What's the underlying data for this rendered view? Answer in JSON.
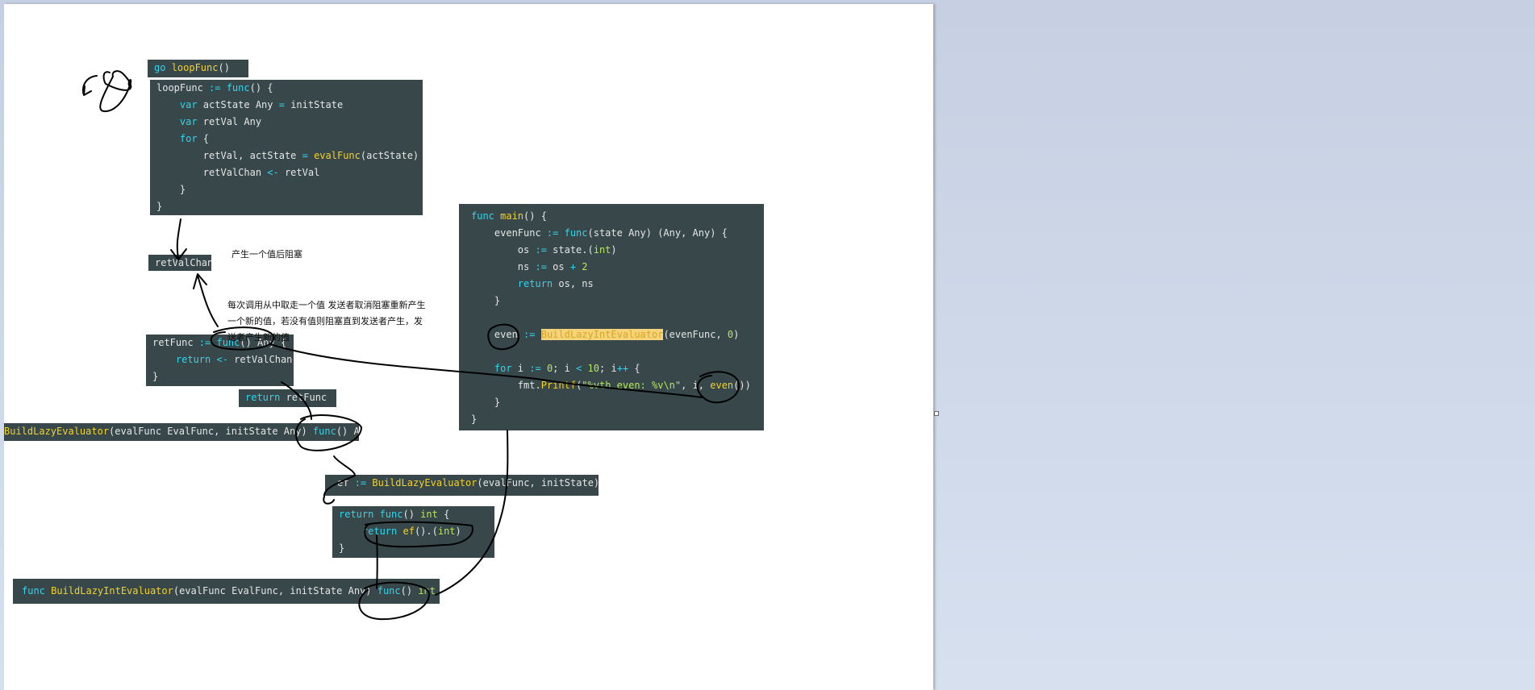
{
  "code_blocks": {
    "go_loop": [
      [
        [
          "kw",
          "go "
        ],
        [
          "fn",
          "loopFunc"
        ],
        [
          "",
          "()"
        ]
      ]
    ],
    "loop_func": [
      [
        [
          "",
          "loopFunc "
        ],
        [
          "op",
          ":="
        ],
        [
          "kw",
          " func"
        ],
        [
          "",
          "() {"
        ]
      ],
      [
        [
          "kw",
          "    var"
        ],
        [
          "",
          " actState Any "
        ],
        [
          "op",
          "="
        ],
        [
          "",
          " initState"
        ]
      ],
      [
        [
          "kw",
          "    var"
        ],
        [
          "",
          " retVal Any"
        ]
      ],
      [
        [
          "kw",
          "    for"
        ],
        [
          "",
          " {"
        ]
      ],
      [
        [
          "",
          "        retVal, actState "
        ],
        [
          "op",
          "="
        ],
        [
          "fn",
          " evalFunc"
        ],
        [
          "",
          "(actState)"
        ]
      ],
      [
        [
          "",
          "        retValChan "
        ],
        [
          "op",
          "<-"
        ],
        [
          "",
          " retVal"
        ]
      ],
      [
        [
          "",
          "    }"
        ]
      ],
      [
        [
          "",
          "}"
        ]
      ]
    ],
    "ret_val_chan": [
      [
        [
          "",
          "retValChan"
        ]
      ]
    ],
    "ret_func": [
      [
        [
          "",
          "retFunc "
        ],
        [
          "op",
          ":="
        ],
        [
          "kw",
          " func"
        ],
        [
          "",
          "() Any {"
        ]
      ],
      [
        [
          "kw",
          "    return"
        ],
        [
          "op",
          " <-"
        ],
        [
          "",
          " retValChan"
        ]
      ],
      [
        [
          "",
          "}"
        ]
      ]
    ],
    "return_ret_func": [
      [
        [
          "kw",
          "return"
        ],
        [
          "",
          " retFunc"
        ]
      ]
    ],
    "build_lazy_evaluator": [
      [
        [
          "fn",
          "BuildLazyEvaluator"
        ],
        [
          "",
          "(evalFunc EvalFunc, initState Any) "
        ],
        [
          "kw",
          "func"
        ],
        [
          "",
          "() Any"
        ]
      ]
    ],
    "ef_assign": [
      [
        [
          "",
          "ef "
        ],
        [
          "op",
          ":="
        ],
        [
          "fn",
          " BuildLazyEvaluator"
        ],
        [
          "",
          "(evalFunc, initState)"
        ]
      ]
    ],
    "return_int_func": [
      [
        [
          "kw",
          "return"
        ],
        [
          "kw",
          " func"
        ],
        [
          "",
          "() "
        ],
        [
          "num",
          "int"
        ],
        [
          "",
          " {"
        ]
      ],
      [
        [
          "kw",
          "    return"
        ],
        [
          "fn",
          " ef"
        ],
        [
          "",
          "()."
        ],
        [
          "",
          "("
        ],
        [
          "num",
          "int"
        ],
        [
          "",
          ")"
        ]
      ],
      [
        [
          "",
          "}"
        ]
      ]
    ],
    "build_lazy_int": [
      [
        [
          "kw",
          "func"
        ],
        [
          "fn",
          " BuildLazyIntEvaluator"
        ],
        [
          "",
          "(evalFunc EvalFunc, initState Any) "
        ],
        [
          "kw",
          "func"
        ],
        [
          "",
          "() "
        ],
        [
          "num",
          "int"
        ],
        [
          "",
          " {"
        ]
      ]
    ],
    "main": [
      [
        [
          "kw",
          "func"
        ],
        [
          "fn",
          " main"
        ],
        [
          "",
          "() {"
        ]
      ],
      [
        [
          "",
          "    evenFunc "
        ],
        [
          "op",
          ":="
        ],
        [
          "kw",
          " func"
        ],
        [
          "",
          "(state Any) (Any, Any) {"
        ]
      ],
      [
        [
          "",
          "        os "
        ],
        [
          "op",
          ":="
        ],
        [
          "",
          " state.("
        ],
        [
          "num",
          "int"
        ],
        [
          "",
          ")"
        ]
      ],
      [
        [
          "",
          "        ns "
        ],
        [
          "op",
          ":="
        ],
        [
          "",
          " os "
        ],
        [
          "op",
          "+"
        ],
        [
          "num",
          " 2"
        ]
      ],
      [
        [
          "kw",
          "        return"
        ],
        [
          "",
          " os, ns"
        ]
      ],
      [
        [
          "",
          "    }"
        ]
      ],
      [
        [
          "",
          ""
        ]
      ],
      [
        [
          "",
          "    even "
        ],
        [
          "op",
          ":="
        ],
        [
          "",
          " "
        ],
        [
          "hl",
          "BuildLazyIntEvaluator"
        ],
        [
          "",
          "(evenFunc, "
        ],
        [
          "num",
          "0"
        ],
        [
          "",
          ")"
        ]
      ],
      [
        [
          "",
          ""
        ]
      ],
      [
        [
          "kw",
          "    for"
        ],
        [
          "",
          " i "
        ],
        [
          "op",
          ":="
        ],
        [
          "num",
          " 0"
        ],
        [
          "",
          "; i "
        ],
        [
          "op",
          "<"
        ],
        [
          "num",
          " 10"
        ],
        [
          "",
          "; i"
        ],
        [
          "op",
          "++"
        ],
        [
          "",
          " {"
        ]
      ],
      [
        [
          "",
          "        fmt."
        ],
        [
          "fn",
          "Printf"
        ],
        [
          "",
          "("
        ],
        [
          "str",
          "\"%vth even: %v\\n\""
        ],
        [
          "",
          ", i, "
        ],
        [
          "fn",
          "even"
        ],
        [
          "",
          "())"
        ]
      ],
      [
        [
          "",
          "    }"
        ]
      ],
      [
        [
          "",
          "}"
        ]
      ]
    ]
  },
  "notes": {
    "produce_then_block": "产生一个值后阻塞",
    "each_call_line1": "每次调用从中取走一个值 发送者取消阻塞重新产生",
    "each_call_line2": "一个新的值，若没有值则阻塞直到发送者产生，发",
    "each_call_line3": "送者产生新的值"
  },
  "colors": {
    "code_bg": "#37474a",
    "keyword": "#2fd6ee",
    "function": "#f3d22b",
    "number": "#b8e65a",
    "highlight": "#f6d27a",
    "ink": "#000000"
  }
}
